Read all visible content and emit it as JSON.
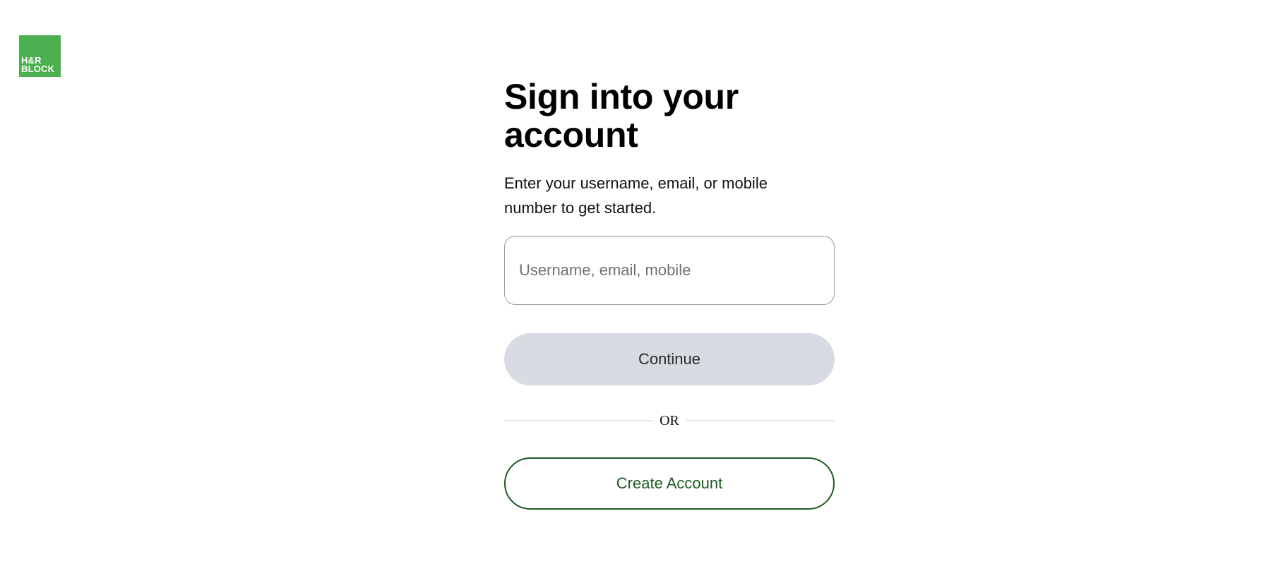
{
  "brand": {
    "logo_line1": "H&R",
    "logo_line2": "BLOCK",
    "color": "#4caf50"
  },
  "signin": {
    "title": "Sign into your account",
    "subtitle": "Enter your username, email, or mobile number to get started.",
    "input_placeholder": "Username, email, mobile",
    "input_value": "",
    "continue_label": "Continue",
    "divider_text": "OR",
    "create_account_label": "Create Account"
  },
  "colors": {
    "continue_bg": "#d8dbe1",
    "create_account_accent": "#1e5a22"
  }
}
